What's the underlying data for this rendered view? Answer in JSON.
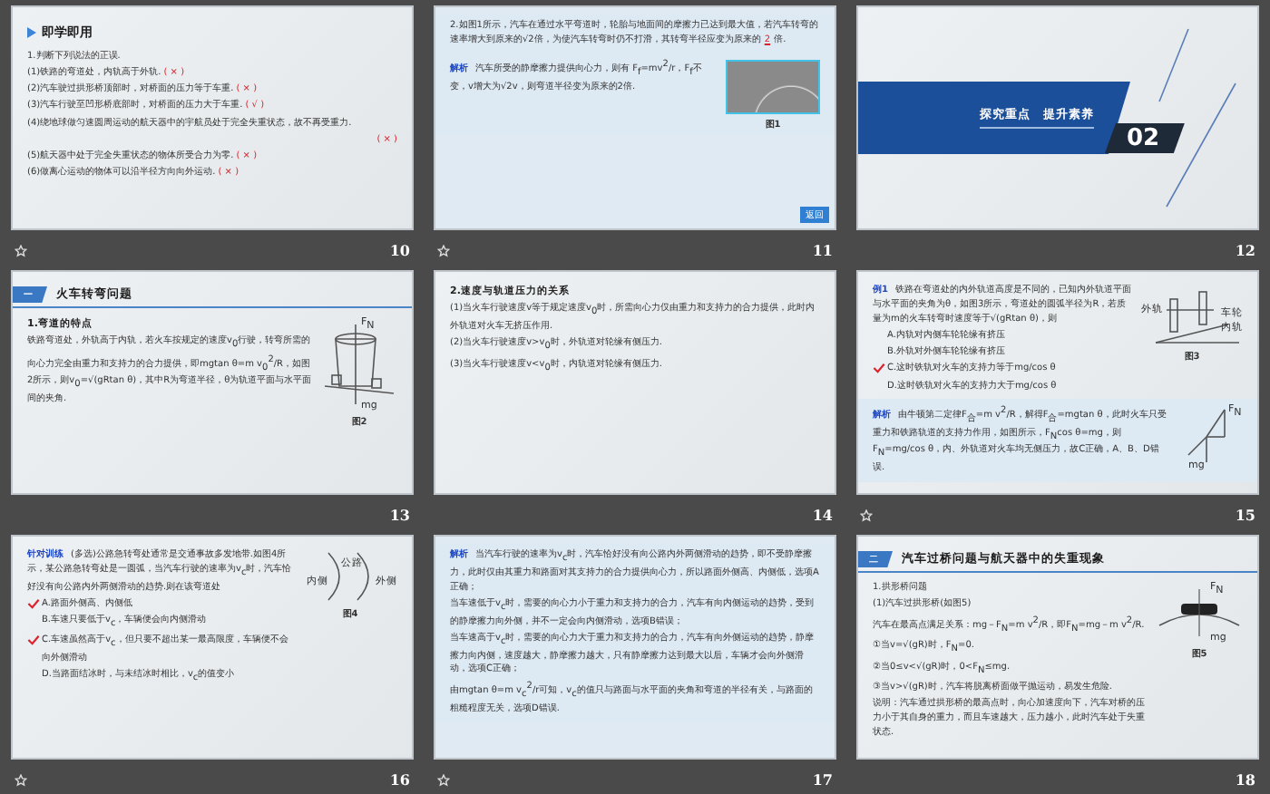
{
  "slides": [
    {
      "number": "10",
      "animated": true,
      "kind": "content",
      "sections": [
        {
          "kind": "plain",
          "blocks": [
            {
              "kind": "title",
              "text": "即学即用"
            },
            {
              "kind": "para",
              "text": "1.判断下列说法的正误."
            },
            {
              "kind": "judge",
              "text": "(1)铁路的弯道处，内轨高于外轨.",
              "answer": "( × )"
            },
            {
              "kind": "judge",
              "text": "(2)汽车驶过拱形桥顶部时，对桥面的压力等于车重.",
              "answer": "( × )"
            },
            {
              "kind": "judge",
              "text": "(3)汽车行驶至凹形桥底部时，对桥面的压力大于车重.",
              "answer": "( √ )"
            },
            {
              "kind": "judge-wrapped",
              "text": "(4)绕地球做匀速圆周运动的航天器中的宇航员处于完全失重状态，故不再受重力.",
              "answer": "( × )"
            },
            {
              "kind": "judge",
              "text": "(5)航天器中处于完全失重状态的物体所受合力为零.",
              "answer": "( × )"
            },
            {
              "kind": "judge",
              "text": "(6)做离心运动的物体可以沿半径方向向外运动.",
              "answer": "( × )"
            }
          ]
        }
      ]
    },
    {
      "number": "11",
      "animated": true,
      "kind": "content",
      "button": "返回",
      "sections": [
        {
          "kind": "tinted",
          "blocks": [
            {
              "kind": "blank",
              "text": "2.如图1所示，汽车在通过水平弯道时，轮胎与地面间的摩擦力已达到最大值，若汽车转弯的速率增大到原来的√2倍，为使汽车转弯时仍不打滑，其转弯半径应变为原来的",
              "answer": "2",
              "after": "倍."
            }
          ]
        },
        {
          "kind": "tinted",
          "blocks": [
            {
              "kind": "lead",
              "label": "解析",
              "text": "汽车所受的静摩擦力提供向心力，则有 F$_{f}$=mv$^{2}$/r，F$_{f}$不变，v增大为√2v，则弯道半径变为原来的2倍."
            }
          ],
          "figure": {
            "kind": "photo",
            "caption": "图1"
          }
        }
      ]
    },
    {
      "number": "12",
      "animated": false,
      "kind": "section",
      "title": "探究重点　提升素养",
      "index": "02"
    },
    {
      "number": "13",
      "animated": false,
      "kind": "content",
      "header": {
        "badge": "一",
        "title": "火车转弯问题"
      },
      "sections": [
        {
          "kind": "plain",
          "blocks": [
            {
              "kind": "subheading",
              "text": "1.弯道的特点"
            },
            {
              "kind": "para",
              "text": "铁路弯道处，外轨高于内轨，若火车按规定的速度v$_{0}$行驶，转弯所需的向心力完全由重力和支持力的合力提供，即mgtan θ=m v$_{0}$$^{2}$/R，如图2所示，则v$_{0}$=√(gRtan θ)，其中R为弯道半径，θ为轨道平面与水平面间的夹角."
            }
          ],
          "figure": {
            "kind": "train",
            "caption": "图2",
            "labels": [
              "F$_{N}$",
              "mg"
            ]
          }
        }
      ]
    },
    {
      "number": "14",
      "animated": false,
      "kind": "content",
      "sections": [
        {
          "kind": "plain",
          "blocks": [
            {
              "kind": "subheading",
              "text": "2.速度与轨道压力的关系"
            },
            {
              "kind": "para",
              "text": "(1)当火车行驶速度v等于规定速度v$_{0}$时，所需向心力仅由重力和支持力的合力提供，此时内外轨道对火车无挤压作用."
            },
            {
              "kind": "para",
              "text": "(2)当火车行驶速度v>v$_{0}$时，外轨道对轮缘有侧压力."
            },
            {
              "kind": "para",
              "text": "(3)当火车行驶速度v<v$_{0}$时，内轨道对轮缘有侧压力."
            }
          ]
        }
      ]
    },
    {
      "number": "15",
      "animated": true,
      "kind": "content",
      "sections": [
        {
          "kind": "plain",
          "blocks": [
            {
              "kind": "lead",
              "label": "例1",
              "text": "铁路在弯道处的内外轨道高度是不同的，已知内外轨道平面与水平面的夹角为θ，如图3所示，弯道处的圆弧半径为R，若质量为m的火车转弯时速度等于√(gRtan θ)，则"
            },
            {
              "kind": "option",
              "text": "A.内轨对内侧车轮轮缘有挤压",
              "checked": false
            },
            {
              "kind": "option",
              "text": "B.外轨对外侧车轮轮缘有挤压",
              "checked": false
            },
            {
              "kind": "option",
              "text": "C.这时铁轨对火车的支持力等于mg/cos θ",
              "checked": true
            },
            {
              "kind": "option",
              "text": "D.这时铁轨对火车的支持力大于mg/cos θ",
              "checked": false
            }
          ],
          "figure": {
            "kind": "incline",
            "caption": "图3",
            "labels": [
              "外轨",
              "车轮",
              "内轨"
            ]
          }
        },
        {
          "kind": "tinted",
          "blocks": [
            {
              "kind": "lead",
              "label": "解析",
              "text": "由牛顿第二定律F$_{合}$=m v$^{2}$/R，解得F$_{合}$=mgtan θ，此时火车只受重力和铁路轨道的支持力作用，如图所示，F$_{N}$cos θ=mg，则F$_{N}$=mg/cos θ，内、外轨道对火车均无侧压力，故C正确，A、B、D错误."
            }
          ],
          "figure": {
            "kind": "force",
            "labels": [
              "F$_{N}$",
              "mg"
            ]
          }
        }
      ]
    },
    {
      "number": "16",
      "animated": true,
      "kind": "content",
      "sections": [
        {
          "kind": "plain",
          "blocks": [
            {
              "kind": "lead",
              "label": "针对训练",
              "text": "(多选)公路急转弯处通常是交通事故多发地带.如图4所示，某公路急转弯处是一圆弧，当汽车行驶的速率为v$_{c}$时，汽车恰好没有向公路内外两侧滑动的趋势.则在该弯道处"
            },
            {
              "kind": "option",
              "text": "A.路面外侧高、内侧低",
              "checked": true
            },
            {
              "kind": "option",
              "text": "B.车速只要低于v$_{c}$，车辆便会向内侧滑动",
              "checked": false
            },
            {
              "kind": "option",
              "text": "C.车速虽然高于v$_{c}$，但只要不超出某一最高限度，车辆便不会向外侧滑动",
              "checked": true
            },
            {
              "kind": "option",
              "text": "D.当路面结冰时，与未结冰时相比，v$_{c}$的值变小",
              "checked": false
            }
          ],
          "figure": {
            "kind": "road",
            "caption": "图4",
            "labels": [
              "内侧",
              "公路",
              "外侧"
            ]
          }
        }
      ]
    },
    {
      "number": "17",
      "animated": true,
      "kind": "content",
      "sections": [
        {
          "kind": "tinted",
          "blocks": [
            {
              "kind": "lead",
              "label": "解析",
              "text": "当汽车行驶的速率为v$_{c}$时，汽车恰好没有向公路内外两侧滑动的趋势，即不受静摩擦力，此时仅由其重力和路面对其支持力的合力提供向心力，所以路面外侧高、内侧低，选项A正确；"
            },
            {
              "kind": "para",
              "text": "当车速低于v$_{c}$时，需要的向心力小于重力和支持力的合力，汽车有向内侧运动的趋势，受到的静摩擦力向外侧，并不一定会向内侧滑动，选项B错误；"
            },
            {
              "kind": "para",
              "text": "当车速高于v$_{c}$时，需要的向心力大于重力和支持力的合力，汽车有向外侧运动的趋势，静摩擦力向内侧，速度越大，静摩擦力越大，只有静摩擦力达到最大以后，车辆才会向外侧滑动，选项C正确；"
            },
            {
              "kind": "para",
              "text": "由mgtan θ=m v$_{c}$$^{2}$/r可知，v$_{c}$的值只与路面与水平面的夹角和弯道的半径有关，与路面的粗糙程度无关，选项D错误."
            }
          ]
        }
      ]
    },
    {
      "number": "18",
      "animated": false,
      "kind": "content",
      "header": {
        "badge": "二",
        "title": "汽车过桥问题与航天器中的失重现象"
      },
      "sections": [
        {
          "kind": "plain",
          "blocks": [
            {
              "kind": "para",
              "text": "1.拱形桥问题"
            },
            {
              "kind": "para",
              "text": "(1)汽车过拱形桥(如图5)"
            },
            {
              "kind": "para",
              "text": "汽车在最高点满足关系：mg－F$_{N}$=m v$^{2}$/R，即F$_{N}$=mg－m v$^{2}$/R."
            },
            {
              "kind": "para",
              "text": "①当v=√(gR)时，F$_{N}$=0."
            },
            {
              "kind": "para",
              "text": "②当0≤v<√(gR)时，0<F$_{N}$≤mg."
            },
            {
              "kind": "para",
              "text": "③当v>√(gR)时，汽车将脱离桥面做平抛运动，易发生危险."
            },
            {
              "kind": "para",
              "text": "说明：汽车通过拱形桥的最高点时，向心加速度向下，汽车对桥的压力小于其自身的重力，而且车速越大，压力越小，此时汽车处于失重状态."
            }
          ],
          "figure": {
            "kind": "bridge",
            "caption": "图5",
            "labels": [
              "F$_{N}$",
              "mg"
            ]
          }
        }
      ]
    }
  ]
}
